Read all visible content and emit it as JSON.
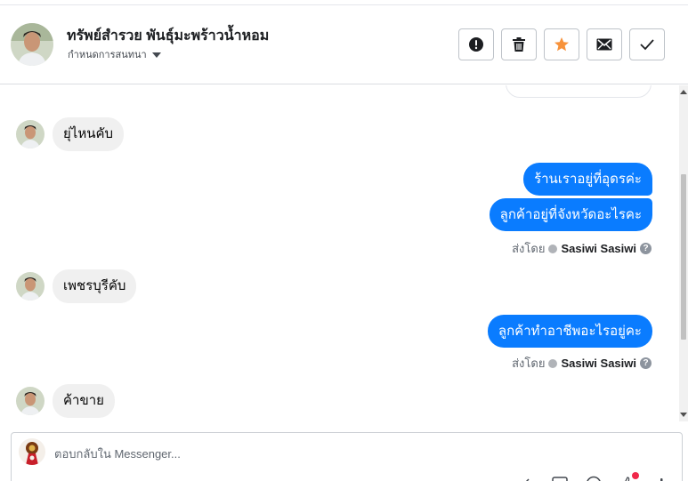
{
  "header": {
    "contact_name": "ทรัพย์สำรวย พันธุ์มะพร้าวน้ำหอม",
    "assign_label": "กำหนดการสนทนา",
    "actions": [
      {
        "name": "report-spam-button",
        "icon": "alert-icon"
      },
      {
        "name": "delete-button",
        "icon": "trash-icon"
      },
      {
        "name": "star-button",
        "icon": "star-icon",
        "color": "#f7923b"
      },
      {
        "name": "mark-unread-button",
        "icon": "envelope-icon"
      },
      {
        "name": "mark-done-button",
        "icon": "check-icon"
      }
    ]
  },
  "conversation": {
    "incoming_1": "ยุ่ไหนคับ",
    "outgoing_1a": "ร้านเราอยู่ที่อุดรค่ะ",
    "outgoing_1b": "ลูกค้าอยู่ที่จังหวัดอะไรคะ",
    "sent_by_1": {
      "label": "ส่งโดย",
      "agent": "Sasiwi Sasiwi"
    },
    "incoming_2": "เพชรบุรีคับ",
    "outgoing_2": "ลูกค้าทำอาชีพอะไรอยู่คะ",
    "sent_by_2": {
      "label": "ส่งโดย",
      "agent": "Sasiwi Sasiwi"
    },
    "incoming_3": "ค้าขาย"
  },
  "composer": {
    "placeholder": "ตอบกลับใน Messenger...",
    "value": ""
  },
  "colors": {
    "outgoing_bubble": "#0a7cff",
    "incoming_bubble": "#f0f0f0",
    "star": "#f7923b"
  }
}
